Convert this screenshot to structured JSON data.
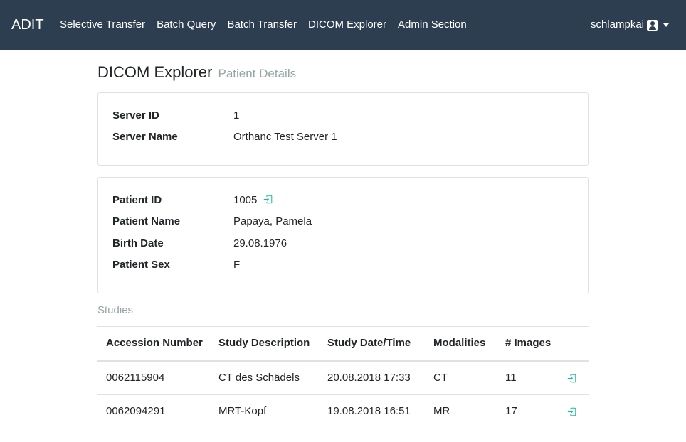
{
  "navbar": {
    "brand": "ADIT",
    "links": [
      "Selective Transfer",
      "Batch Query",
      "Batch Transfer",
      "DICOM Explorer",
      "Admin Section"
    ],
    "user": "schlampkai"
  },
  "page": {
    "title": "DICOM Explorer",
    "subtitle": "Patient Details"
  },
  "server": {
    "id_label": "Server ID",
    "id_value": "1",
    "name_label": "Server Name",
    "name_value": "Orthanc Test Server 1"
  },
  "patient": {
    "id_label": "Patient ID",
    "id_value": "1005",
    "name_label": "Patient Name",
    "name_value": "Papaya, Pamela",
    "birth_label": "Birth Date",
    "birth_value": "29.08.1976",
    "sex_label": "Patient Sex",
    "sex_value": "F"
  },
  "studies": {
    "label": "Studies",
    "columns": [
      "Accession Number",
      "Study Description",
      "Study Date/Time",
      "Modalities",
      "# Images"
    ],
    "rows": [
      [
        "0062115904",
        "CT des Schädels",
        "20.08.2018 17:33",
        "CT",
        "11"
      ],
      [
        "0062094291",
        "MRT-Kopf",
        "19.08.2018 16:51",
        "MR",
        "17"
      ]
    ]
  },
  "colors": {
    "navbar_bg": "#2c3e50",
    "muted": "#95a5a6",
    "link_icon": "#18bc9c"
  }
}
